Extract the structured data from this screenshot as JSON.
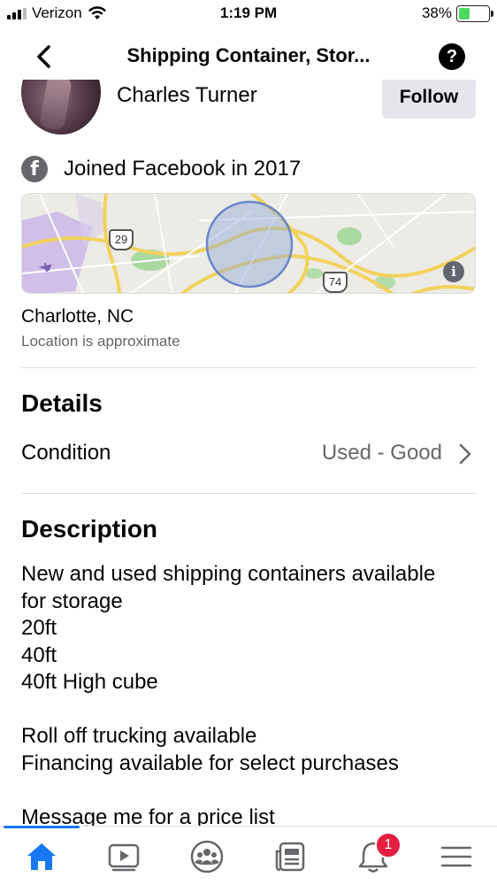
{
  "status_bar": {
    "carrier": "Verizon",
    "time": "1:19 PM",
    "battery_percent": "38%",
    "battery_level": 0.38,
    "icons": [
      "signal-icon",
      "wifi-icon",
      "battery-charging-icon"
    ]
  },
  "header": {
    "title": "Shipping Container, Stor...",
    "back_icon": "chevron-left-icon",
    "help_label": "?"
  },
  "seller": {
    "name": "Charles Turner",
    "follow_label": "Follow",
    "joined": "Joined Facebook in 2017"
  },
  "map": {
    "shields": [
      "29",
      "74"
    ],
    "info_label": "i"
  },
  "location": {
    "city": "Charlotte, NC",
    "note": "Location is approximate"
  },
  "details": {
    "heading": "Details",
    "condition_label": "Condition",
    "condition_value": "Used - Good"
  },
  "description": {
    "heading": "Description",
    "lines": [
      "New and used shipping containers available",
      "for storage",
      "20ft",
      "40ft",
      "40ft High cube",
      "",
      "Roll off trucking available",
      "Financing available for select purchases",
      "",
      "Message me for a price list"
    ]
  },
  "tab_bar": {
    "tabs": [
      "home-icon",
      "watch-icon",
      "groups-icon",
      "news-icon",
      "notifications-icon",
      "menu-icon"
    ],
    "active": "home-icon",
    "notification_count": "1",
    "colors": {
      "active": "#1877f2",
      "inactive": "#65676b",
      "badge": "#e41e3f"
    }
  }
}
